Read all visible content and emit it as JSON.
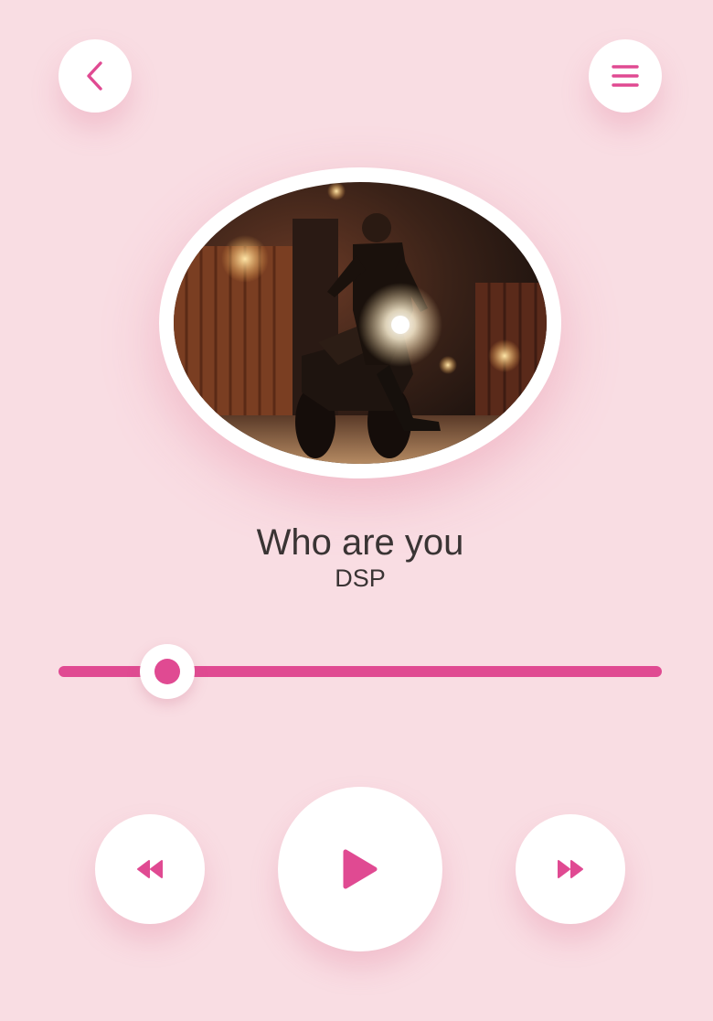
{
  "header": {
    "back_icon": "chevron-left-icon",
    "menu_icon": "hamburger-menu-icon"
  },
  "track": {
    "title": "Who are you",
    "artist": "DSP"
  },
  "progress": {
    "fraction": 0.18
  },
  "controls": {
    "rewind_icon": "rewind-icon",
    "play_icon": "play-icon",
    "forward_icon": "fast-forward-icon"
  },
  "theme": {
    "background": "#f9dde3",
    "accent": "#e04a92",
    "text": "#3a3434"
  }
}
